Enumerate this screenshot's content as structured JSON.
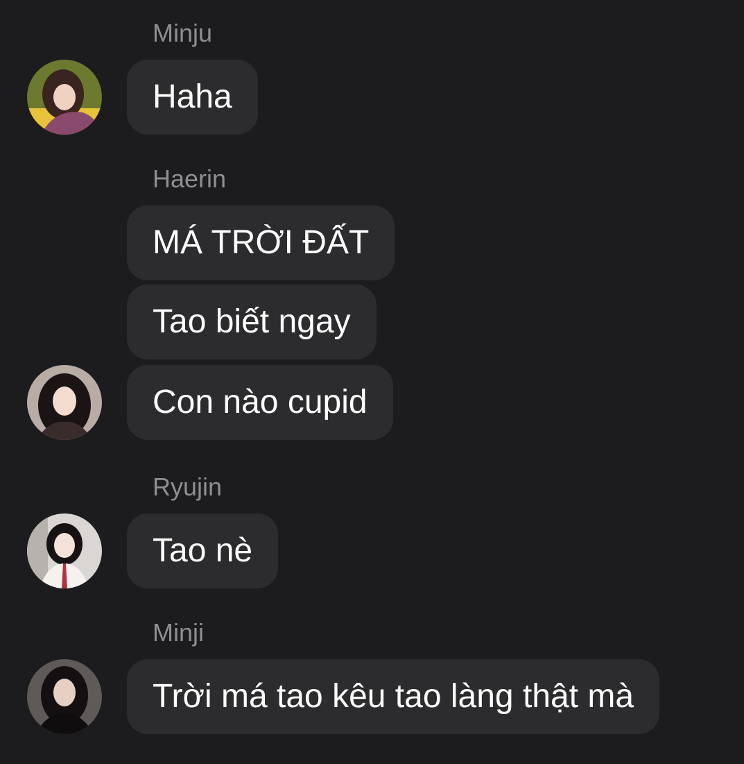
{
  "colors": {
    "background": "#1c1c1e",
    "bubble": "#2c2c2e",
    "sender_name": "#8e8e93",
    "message_text": "#ffffff"
  },
  "messages": [
    {
      "sender": "Minju",
      "avatar": "minju-avatar",
      "texts": [
        "Haha"
      ]
    },
    {
      "sender": "Haerin",
      "avatar": "haerin-avatar",
      "texts": [
        "MÁ TRỜI ĐẤT",
        "Tao biết ngay",
        "Con nào cupid"
      ]
    },
    {
      "sender": "Ryujin",
      "avatar": "ryujin-avatar",
      "texts": [
        "Tao nè"
      ]
    },
    {
      "sender": "Minji",
      "avatar": "minji-avatar",
      "texts": [
        "Trời má tao kêu tao làng thật mà"
      ]
    }
  ]
}
